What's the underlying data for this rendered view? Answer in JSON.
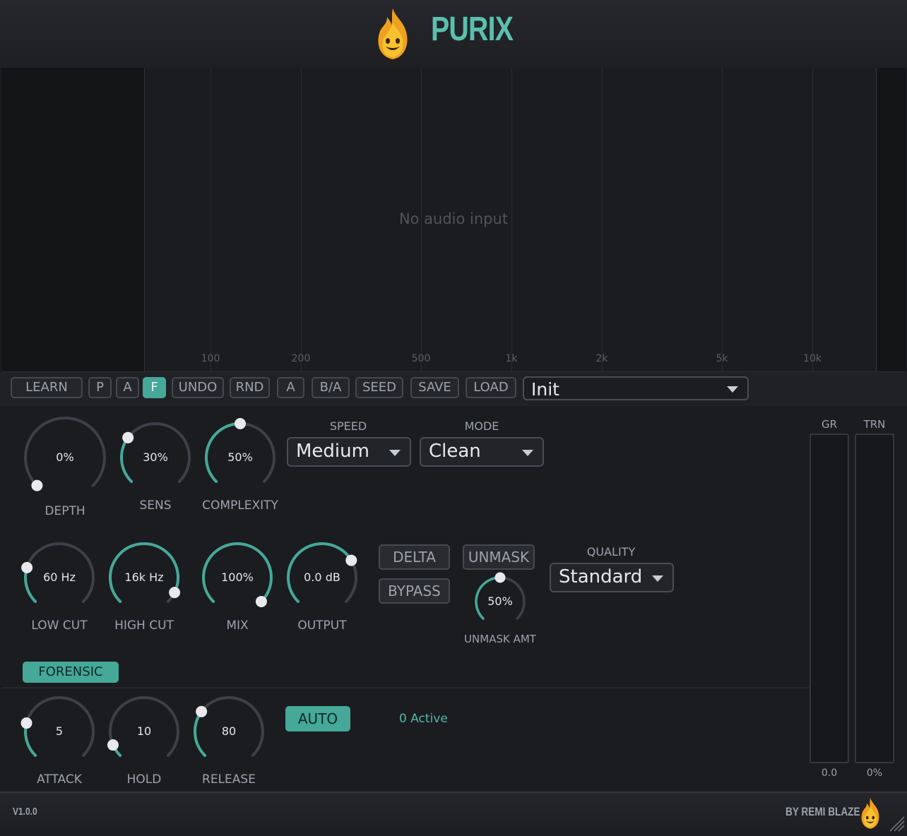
{
  "app": {
    "title": "PURIX"
  },
  "colors": {
    "accent": "#45a898",
    "title": "#5bbfae",
    "background": "#1b1c20",
    "track": "#3e4048"
  },
  "spectrum": {
    "empty_message": "No audio input",
    "freq_labels": [
      "100",
      "200",
      "500",
      "1k",
      "2k",
      "5k",
      "10k"
    ]
  },
  "toolbar": {
    "buttons": [
      {
        "label": "LEARN",
        "active": false
      },
      {
        "label": "P",
        "active": false
      },
      {
        "label": "A",
        "active": false
      },
      {
        "label": "F",
        "active": true
      },
      {
        "label": "UNDO",
        "active": false
      },
      {
        "label": "RND",
        "active": false
      },
      {
        "label": "A",
        "active": false
      },
      {
        "label": "B/A",
        "active": false
      },
      {
        "label": "SEED",
        "active": false
      },
      {
        "label": "SAVE",
        "active": false
      },
      {
        "label": "LOAD",
        "active": false
      }
    ],
    "preset": "Init"
  },
  "knobs": {
    "depth": {
      "value": "0%",
      "label": "DEPTH",
      "level": 0.0
    },
    "sens": {
      "value": "30%",
      "label": "SENS",
      "level": 0.3
    },
    "complexity": {
      "value": "50%",
      "label": "COMPLEXITY",
      "level": 0.5
    },
    "low_cut": {
      "value": "60 Hz",
      "label": "LOW CUT",
      "level": 0.23
    },
    "high_cut": {
      "value": "16k Hz",
      "label": "HIGH CUT",
      "level": 0.93
    },
    "mix": {
      "value": "100%",
      "label": "MIX",
      "level": 1.0
    },
    "output": {
      "value": "0.0 dB",
      "label": "OUTPUT",
      "level": 0.72
    },
    "unmask_amt": {
      "value": "50%",
      "label": "UNMASK AMT",
      "level": 0.5
    },
    "attack": {
      "value": "5",
      "label": "ATTACK",
      "level": 0.22
    },
    "hold": {
      "value": "10",
      "label": "HOLD",
      "level": 0.08
    },
    "release": {
      "value": "80",
      "label": "RELEASE",
      "level": 0.3
    }
  },
  "speed": {
    "label": "SPEED",
    "value": "Medium"
  },
  "mode": {
    "label": "MODE",
    "value": "Clean"
  },
  "quality": {
    "label": "QUALITY",
    "value": "Standard"
  },
  "buttons": {
    "delta": "DELTA",
    "bypass": "BYPASS",
    "unmask": "UNMASK",
    "forensic": "FORENSIC",
    "auto": "AUTO"
  },
  "status": {
    "active": "0 Active"
  },
  "meters": {
    "gr": {
      "label": "GR",
      "value": "0.0"
    },
    "trn": {
      "label": "TRN",
      "value": "0%"
    }
  },
  "footer": {
    "version": "V1.0.0",
    "credit": "BY REMI BLAZE"
  }
}
